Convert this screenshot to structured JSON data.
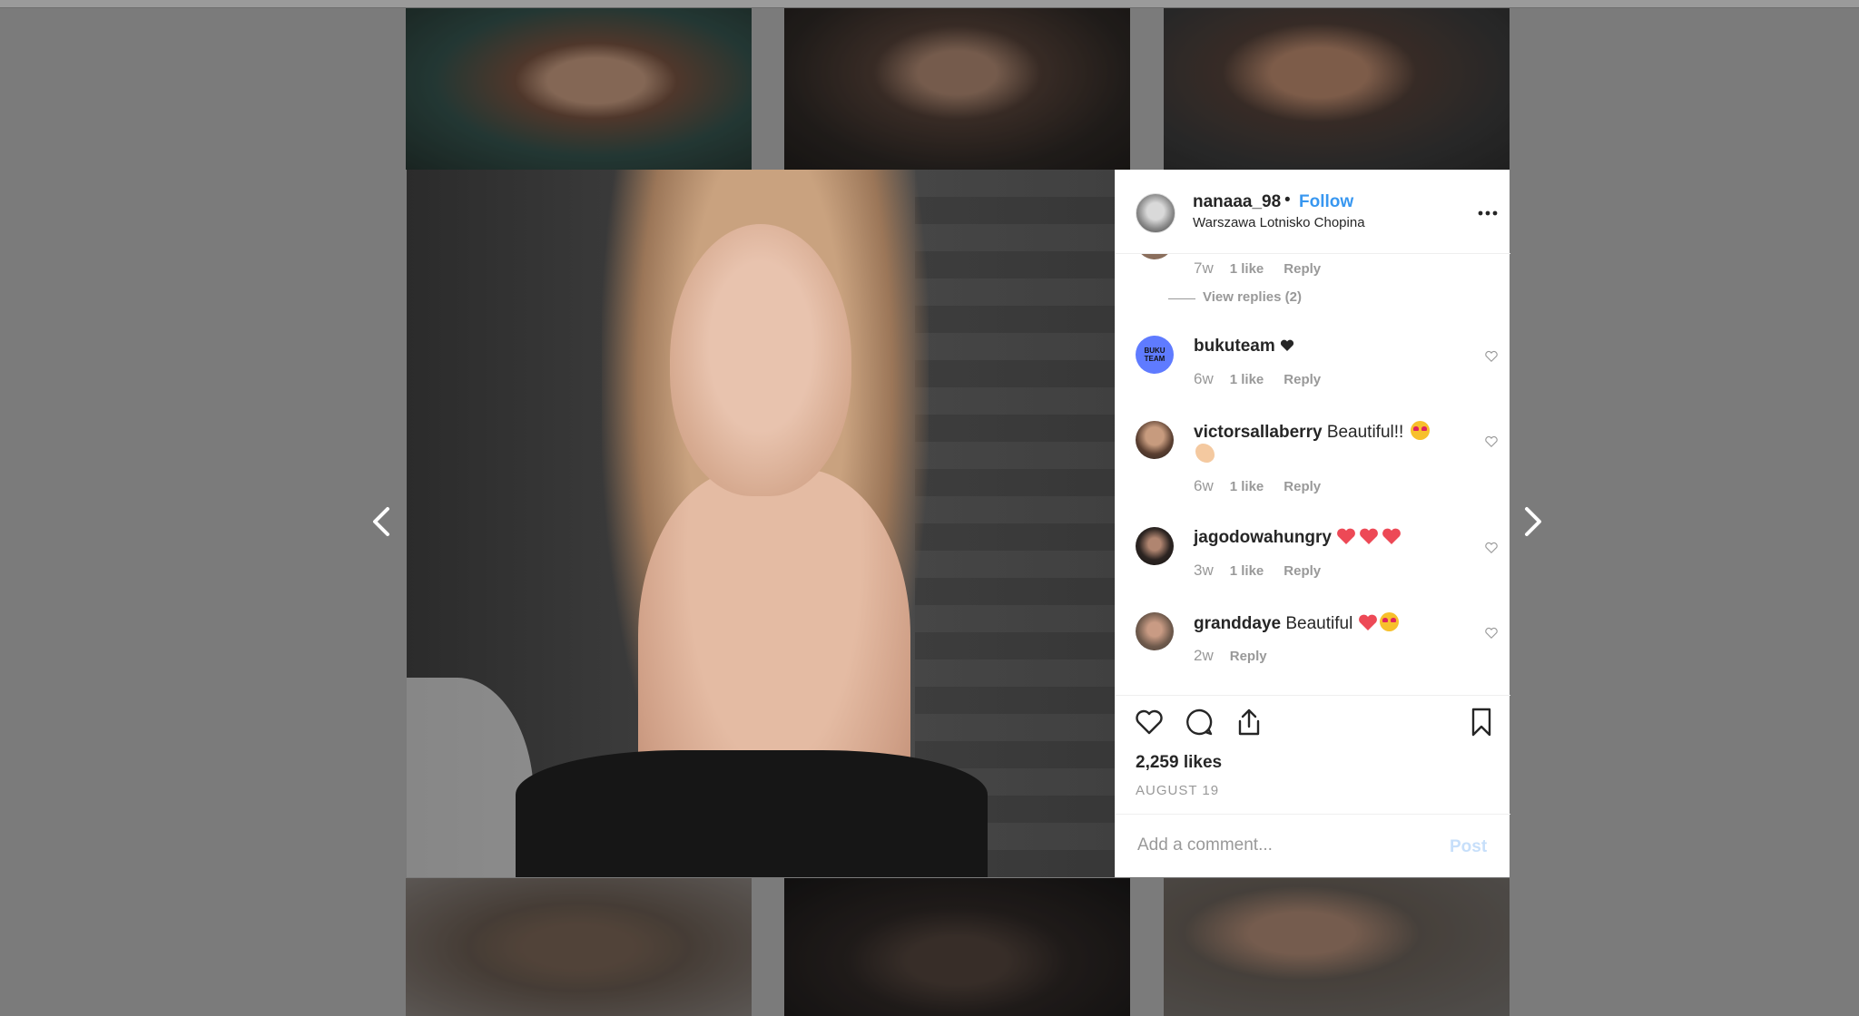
{
  "post": {
    "username": "nanaaa_98",
    "separator": "•",
    "follow_label": "Follow",
    "location": "Warszawa Lotnisko Chopina"
  },
  "partial_comment": {
    "time": "7w",
    "likes": "1 like",
    "reply": "Reply",
    "view_replies": "View replies (2)"
  },
  "comments": [
    {
      "user": "bukuteam",
      "text": "",
      "emoji": [
        "black-heart"
      ],
      "time": "6w",
      "likes": "1 like",
      "reply": "Reply",
      "avatar_label": "BUKU TEAM",
      "avatar_color": "#5f7bff"
    },
    {
      "user": "victorsallaberry",
      "text": "Beautiful!!",
      "emoji": [
        "heart-eyes",
        "clap"
      ],
      "time": "6w",
      "likes": "1 like",
      "reply": "Reply"
    },
    {
      "user": "jagodowahungry",
      "text": "",
      "emoji": [
        "red-heart",
        "red-heart",
        "red-heart"
      ],
      "time": "3w",
      "likes": "1 like",
      "reply": "Reply"
    },
    {
      "user": "granddaye",
      "text": "Beautiful",
      "emoji": [
        "red-heart",
        "heart-eyes"
      ],
      "time": "2w",
      "likes": "",
      "reply": "Reply"
    }
  ],
  "stats": {
    "likes": "2,259 likes",
    "date": "AUGUST 19"
  },
  "add_comment": {
    "placeholder": "Add a comment...",
    "post_label": "Post"
  },
  "colors": {
    "link": "#3897f0",
    "text": "#262626",
    "muted": "#999999",
    "post_disabled": "#c7dffa",
    "heart_red": "#ed4956"
  }
}
